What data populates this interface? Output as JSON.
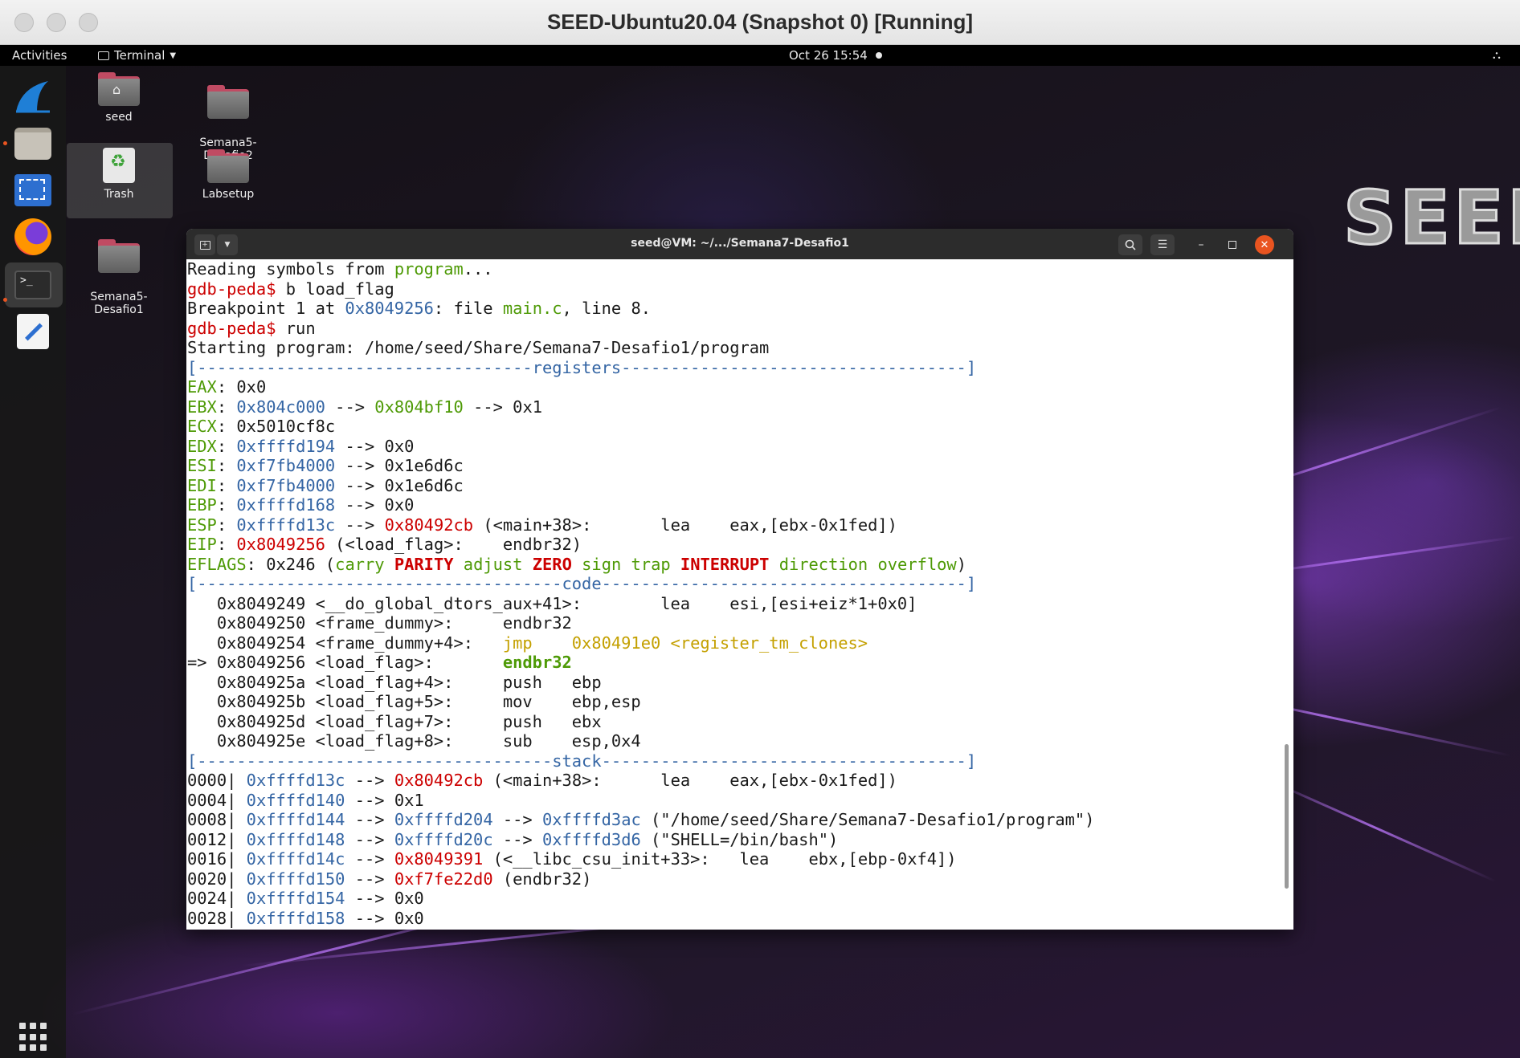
{
  "mac_window": {
    "title": "SEED-Ubuntu20.04 (Snapshot 0) [Running]"
  },
  "topbar": {
    "activities": "Activities",
    "app_menu": "Terminal",
    "clock": "Oct 26  15:54",
    "system_menu_icon": "network-icon"
  },
  "dock": {
    "items": [
      "wireshark-icon",
      "files-icon",
      "screenshot-icon",
      "firefox-icon",
      "terminal-icon",
      "text-editor-icon"
    ],
    "apps_button_icon": "show-applications-icon"
  },
  "desktop": {
    "icons": [
      {
        "label": "seed"
      },
      {
        "label": "Semana5-\nDesafio2"
      },
      {
        "label": "Trash"
      },
      {
        "label": "Labsetup"
      },
      {
        "label": "Semana5-\nDesafio1"
      }
    ],
    "logo": "SEED"
  },
  "terminal": {
    "title": "seed@VM: ~/.../Semana7-Desafio1",
    "lines": [
      [
        [
          "",
          "Reading symbols from "
        ],
        [
          "g",
          "program"
        ],
        [
          "",
          "..."
        ]
      ],
      [
        [
          "r",
          "gdb-peda$"
        ],
        [
          "",
          " b load_flag"
        ]
      ],
      [
        [
          "",
          "Breakpoint 1 at "
        ],
        [
          "b",
          "0x8049256"
        ],
        [
          "",
          ": file "
        ],
        [
          "g",
          "main.c"
        ],
        [
          "",
          ", line 8."
        ]
      ],
      [
        [
          "r",
          "gdb-peda$"
        ],
        [
          "",
          " run"
        ]
      ],
      [
        [
          "",
          "Starting program: /home/seed/Share/Semana7-Desafio1/program"
        ]
      ],
      [
        [
          "b",
          "[----------------------------------registers-----------------------------------]"
        ]
      ],
      [
        [
          "g",
          "EAX"
        ],
        [
          "",
          ": 0x0"
        ]
      ],
      [
        [
          "g",
          "EBX"
        ],
        [
          "",
          ": "
        ],
        [
          "b",
          "0x804c000"
        ],
        [
          "",
          " --> "
        ],
        [
          "g",
          "0x804bf10"
        ],
        [
          "",
          " --> 0x1"
        ]
      ],
      [
        [
          "g",
          "ECX"
        ],
        [
          "",
          ": 0x5010cf8c"
        ]
      ],
      [
        [
          "g",
          "EDX"
        ],
        [
          "",
          ": "
        ],
        [
          "b",
          "0xffffd194"
        ],
        [
          "",
          " --> 0x0"
        ]
      ],
      [
        [
          "g",
          "ESI"
        ],
        [
          "",
          ": "
        ],
        [
          "b",
          "0xf7fb4000"
        ],
        [
          "",
          " --> 0x1e6d6c"
        ]
      ],
      [
        [
          "g",
          "EDI"
        ],
        [
          "",
          ": "
        ],
        [
          "b",
          "0xf7fb4000"
        ],
        [
          "",
          " --> 0x1e6d6c"
        ]
      ],
      [
        [
          "g",
          "EBP"
        ],
        [
          "",
          ": "
        ],
        [
          "b",
          "0xffffd168"
        ],
        [
          "",
          " --> 0x0"
        ]
      ],
      [
        [
          "g",
          "ESP"
        ],
        [
          "",
          ": "
        ],
        [
          "b",
          "0xffffd13c"
        ],
        [
          "",
          " --> "
        ],
        [
          "r",
          "0x80492cb"
        ],
        [
          "",
          " (<main+38>:       lea    eax,[ebx-0x1fed])"
        ]
      ],
      [
        [
          "g",
          "EIP"
        ],
        [
          "",
          ": "
        ],
        [
          "r",
          "0x8049256"
        ],
        [
          "",
          " (<load_flag>:    endbr32)"
        ]
      ],
      [
        [
          "g",
          "EFLAGS"
        ],
        [
          "",
          ": 0x246 ("
        ],
        [
          "g",
          "carry"
        ],
        [
          "",
          " "
        ],
        [
          "rb",
          "PARITY"
        ],
        [
          "",
          " "
        ],
        [
          "g",
          "adjust"
        ],
        [
          "",
          " "
        ],
        [
          "rb",
          "ZERO"
        ],
        [
          "",
          " "
        ],
        [
          "g",
          "sign"
        ],
        [
          "",
          " "
        ],
        [
          "g",
          "trap"
        ],
        [
          "",
          " "
        ],
        [
          "rb",
          "INTERRUPT"
        ],
        [
          "",
          " "
        ],
        [
          "g",
          "direction"
        ],
        [
          "",
          " "
        ],
        [
          "g",
          "overflow"
        ],
        [
          "",
          ")"
        ]
      ],
      [
        [
          "b",
          "[-------------------------------------code-------------------------------------]"
        ]
      ],
      [
        [
          "",
          "   0x8049249 <__do_global_dtors_aux+41>:        lea    esi,[esi+eiz*1+0x0]"
        ]
      ],
      [
        [
          "",
          "   0x8049250 <frame_dummy>:     endbr32"
        ]
      ],
      [
        [
          "",
          "   0x8049254 <frame_dummy+4>:   "
        ],
        [
          "y",
          "jmp    0x80491e0 <register_tm_clones>"
        ]
      ],
      [
        [
          "",
          "=> 0x8049256 <load_flag>:       "
        ],
        [
          "gb",
          "endbr32"
        ]
      ],
      [
        [
          "",
          "   0x804925a <load_flag+4>:     push   ebp"
        ]
      ],
      [
        [
          "",
          "   0x804925b <load_flag+5>:     mov    ebp,esp"
        ]
      ],
      [
        [
          "",
          "   0x804925d <load_flag+7>:     push   ebx"
        ]
      ],
      [
        [
          "",
          "   0x804925e <load_flag+8>:     sub    esp,0x4"
        ]
      ],
      [
        [
          "b",
          "[------------------------------------stack-------------------------------------]"
        ]
      ],
      [
        [
          "",
          "0000| "
        ],
        [
          "b",
          "0xffffd13c"
        ],
        [
          "",
          " --> "
        ],
        [
          "r",
          "0x80492cb"
        ],
        [
          "",
          " (<main+38>:      lea    eax,[ebx-0x1fed])"
        ]
      ],
      [
        [
          "",
          "0004| "
        ],
        [
          "b",
          "0xffffd140"
        ],
        [
          "",
          " --> 0x1"
        ]
      ],
      [
        [
          "",
          "0008| "
        ],
        [
          "b",
          "0xffffd144"
        ],
        [
          "",
          " --> "
        ],
        [
          "b",
          "0xffffd204"
        ],
        [
          "",
          " --> "
        ],
        [
          "b",
          "0xffffd3ac"
        ],
        [
          "",
          " (\"/home/seed/Share/Semana7-Desafio1/program\")"
        ]
      ],
      [
        [
          "",
          "0012| "
        ],
        [
          "b",
          "0xffffd148"
        ],
        [
          "",
          " --> "
        ],
        [
          "b",
          "0xffffd20c"
        ],
        [
          "",
          " --> "
        ],
        [
          "b",
          "0xffffd3d6"
        ],
        [
          "",
          " (\"SHELL=/bin/bash\")"
        ]
      ],
      [
        [
          "",
          "0016| "
        ],
        [
          "b",
          "0xffffd14c"
        ],
        [
          "",
          " --> "
        ],
        [
          "r",
          "0x8049391"
        ],
        [
          "",
          " (<__libc_csu_init+33>:   lea    ebx,[ebp-0xf4])"
        ]
      ],
      [
        [
          "",
          "0020| "
        ],
        [
          "b",
          "0xffffd150"
        ],
        [
          "",
          " --> "
        ],
        [
          "r",
          "0xf7fe22d0"
        ],
        [
          "",
          " (endbr32)"
        ]
      ],
      [
        [
          "",
          "0024| "
        ],
        [
          "b",
          "0xffffd154"
        ],
        [
          "",
          " --> 0x0"
        ]
      ],
      [
        [
          "",
          "0028| "
        ],
        [
          "b",
          "0xffffd158"
        ],
        [
          "",
          " --> 0x0"
        ]
      ]
    ]
  }
}
